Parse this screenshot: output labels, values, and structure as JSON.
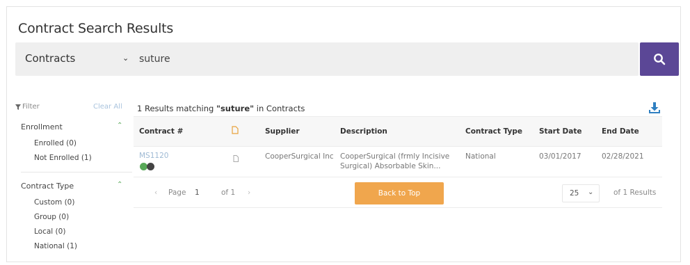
{
  "page_title": "Contract Search Results",
  "search": {
    "scope": "Contracts",
    "query": "suture"
  },
  "filter": {
    "label": "Filter",
    "clear_all": "Clear All",
    "groups": [
      {
        "title": "Enrollment",
        "options": [
          "Enrolled (0)",
          "Not Enrolled (1)"
        ]
      },
      {
        "title": "Contract Type",
        "options": [
          "Custom (0)",
          "Group (0)",
          "Local (0)",
          "National (1)"
        ]
      }
    ]
  },
  "results": {
    "count_text": "1 Results matching ",
    "query_bold": "\"suture\"",
    "suffix": " in Contracts"
  },
  "table": {
    "headers": {
      "contract": "Contract #",
      "supplier": "Supplier",
      "description": "Description",
      "contract_type": "Contract Type",
      "start_date": "Start Date",
      "end_date": "End Date"
    },
    "rows": [
      {
        "contract": "MS1120",
        "supplier": "CooperSurgical Inc",
        "description_line1": "CooperSurgical (frmly Incisive",
        "description_line2": "Surgical) Absorbable Skin...",
        "contract_type": "National",
        "start_date": "03/01/2017",
        "end_date": "02/28/2021"
      }
    ]
  },
  "pager": {
    "prev": "‹",
    "page_label": "Page",
    "page_value": "1",
    "of_label": "of 1",
    "next": "›",
    "back_to_top": "Back to Top",
    "page_size": "25",
    "results_label": "of 1 Results"
  },
  "colors": {
    "accent": "#5b4796",
    "orange": "#f0a64d",
    "green": "#58a858",
    "download_blue": "#2f7fc1"
  }
}
